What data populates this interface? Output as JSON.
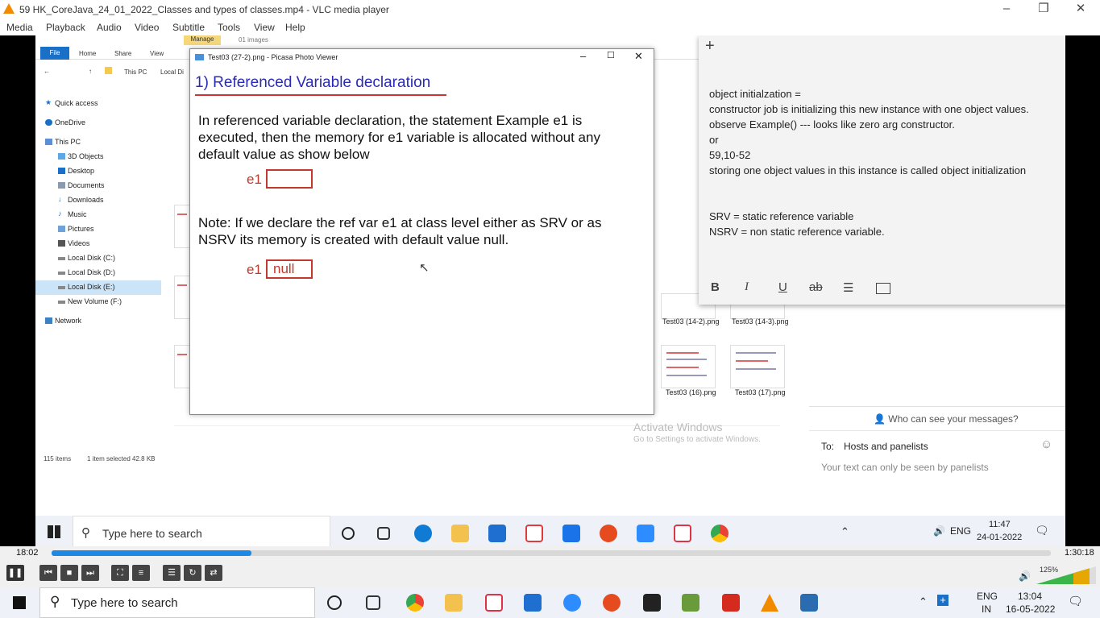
{
  "vlc": {
    "title": "59 HK_CoreJava_24_01_2022_Classes and types of classes.mp4 - VLC media player",
    "menu": [
      "Media",
      "Playback",
      "Audio",
      "Video",
      "Subtitle",
      "Tools",
      "View",
      "Help"
    ],
    "time_elapsed": "18:02",
    "time_total": "1:30:18",
    "progress_fraction": 0.2,
    "volume": "125%"
  },
  "explorer": {
    "manage": "Manage",
    "images_count": "01 images",
    "ribbon_tabs": [
      "File",
      "Home",
      "Share",
      "View"
    ],
    "address": [
      "This PC",
      "Local Di"
    ],
    "nav": [
      "Quick access",
      "OneDrive",
      "This PC",
      "3D Objects",
      "Desktop",
      "Documents",
      "Downloads",
      "Music",
      "Pictures",
      "Videos",
      "Local Disk (C:)",
      "Local Disk (D:)",
      "Local Disk (E:)",
      "New Volume (F:)",
      "Network"
    ],
    "status_items": "115 items",
    "status_selected": "1 item selected  42.8 KB",
    "thumb_labels": [
      "Test03 (14-2).png",
      "Test03 (14-3).png",
      "Test03 (16).png",
      "Test03 (17).png"
    ]
  },
  "picasa": {
    "title": "Test03 (27-2).png - Picasa Photo Viewer",
    "heading": "1) Referenced Variable declaration",
    "para1": "In referenced variable declaration, the statement Example e1 is executed, then the memory for e1 variable is allocated without any default value as show below",
    "var_label": "e1",
    "para2": "Note: If we declare the ref var e1 at class level either as SRV or as NSRV its memory is created with default value null.",
    "null_value": "null"
  },
  "note": {
    "lines": [
      "object initialzation =",
      "constructor job is initializing this new instance with one object values.",
      "observe Example() --- looks like zero arg constructor.",
      "or",
      "59,10-52",
      "storing one object values in this instance is called object initialization",
      "",
      "",
      "SRV = static reference variable",
      "NSRV = non static reference variable."
    ],
    "tools": [
      "B",
      "I",
      "U",
      "ab"
    ]
  },
  "zoom": {
    "who_can_see": "Who can see your messages?",
    "to_label": "To:",
    "to_value": "Hosts and panelists",
    "hint": "Your text can only be seen by panelists",
    "activate_title": "Activate Windows",
    "activate_sub": "Go to Settings to activate Windows."
  },
  "inner_taskbar": {
    "search": "Type here to search",
    "lang": "ENG",
    "time": "11:47",
    "date": "24-01-2022",
    "notif": "5"
  },
  "taskbar": {
    "search": "Type here to search",
    "lang": "ENG",
    "region": "IN",
    "time": "13:04",
    "date": "16-05-2022",
    "notif": "2"
  }
}
